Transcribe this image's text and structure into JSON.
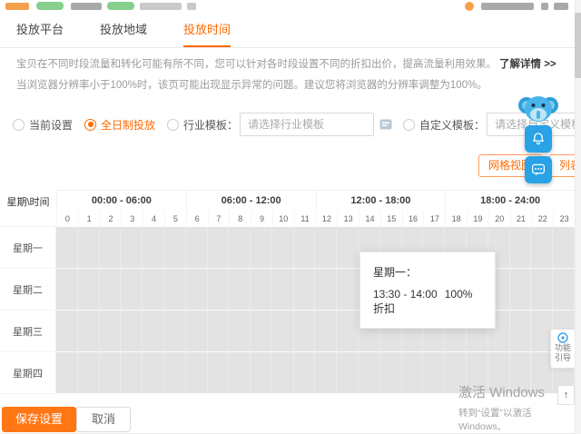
{
  "tabs": {
    "items": [
      "投放平台",
      "投放地域",
      "投放时间"
    ],
    "active_index": 2
  },
  "notice": {
    "line1": "宝贝在不同时段流量和转化可能有所不同，您可以针对各时段设置不同的折扣出价，提高流量利用效果。",
    "line1_link": "了解详情 >>",
    "line2": "当浏览器分辨率小于100%时，该页可能出现显示异常的问题。建议您将浏览器的分辨率调整为100%。"
  },
  "template_options": {
    "current_label": "当前设置",
    "full_day_label": "全日制投放",
    "industry_label": "行业模板：",
    "industry_placeholder": "请选择行业模板",
    "custom_label": "自定义模板：",
    "custom_placeholder": "请选择自定义模板",
    "selected": "全日制投放"
  },
  "view_toggle": {
    "grid_label": "网格视图",
    "list_label": "列表视图"
  },
  "schedule": {
    "corner": "星期\\时间",
    "time_groups": [
      "00:00 - 06:00",
      "06:00 - 12:00",
      "12:00 - 18:00",
      "18:00 - 24:00"
    ],
    "hours": [
      "0",
      "1",
      "2",
      "3",
      "4",
      "5",
      "6",
      "7",
      "8",
      "9",
      "10",
      "11",
      "12",
      "13",
      "14",
      "15",
      "16",
      "17",
      "18",
      "19",
      "20",
      "21",
      "22",
      "23"
    ],
    "days": [
      "星期一",
      "星期二",
      "星期三",
      "星期四"
    ],
    "tooltip": {
      "title": "星期一：",
      "range": "13:30 - 14:00",
      "discount": "100%折扣"
    }
  },
  "footer": {
    "save_label": "保存设置",
    "cancel_label": "取消"
  },
  "side_widgets": {
    "guide_line1": "功能",
    "guide_line2": "引导",
    "back_top_glyph": "↑"
  },
  "watermark": {
    "line1": "激活 Windows",
    "line2": "转到“设置”以激活 Windows。"
  },
  "icons": {
    "bell": "bell-icon",
    "chat": "chat-icon",
    "mascot": "elephant-mascot",
    "badge": "template-badge-icon",
    "guide": "guide-icon"
  },
  "colors": {
    "accent": "#ff6a00",
    "widget_blue": "#29a2e6",
    "grid_cell": "#e3e3e3",
    "tab_active": "#ff6a00"
  }
}
